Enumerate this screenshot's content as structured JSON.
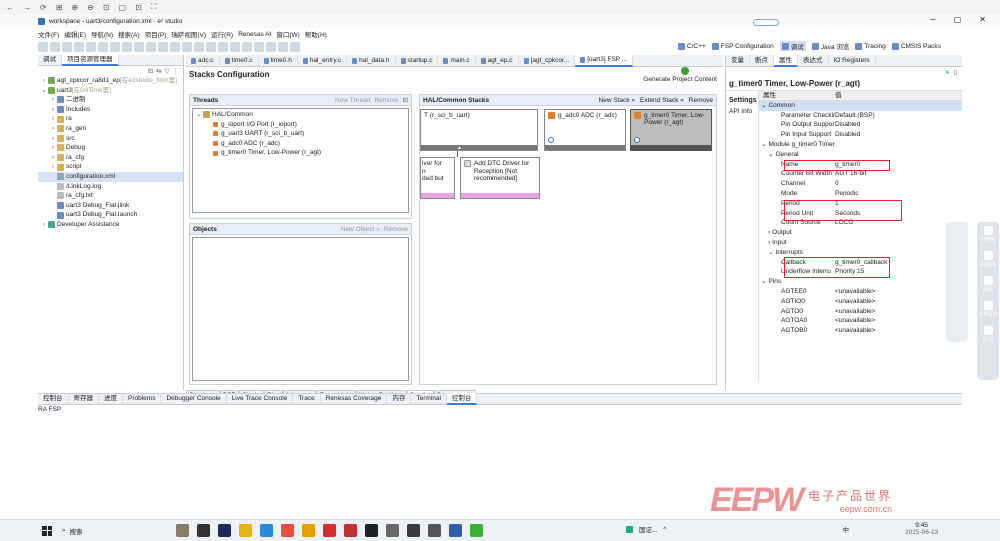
{
  "window": {
    "title": "workspace - uart3/configuration.xml - e² studio",
    "win_controls": [
      "─",
      "▢",
      "✕"
    ]
  },
  "browser_bar": [
    "←",
    "→",
    "⟳",
    "⊞",
    "⊕",
    "⊖",
    "⊡",
    "▢",
    "⊡",
    "⛶"
  ],
  "menu": [
    "文件(F)",
    "编辑(E)",
    "导航(N)",
    "搜索(A)",
    "项目(P)",
    "瑞萨视图(V)",
    "运行(R)",
    "Renesas AI",
    "窗口(W)",
    "帮助(H)"
  ],
  "perspectives": [
    "C/C++",
    "FSP Configuration",
    "调试",
    "Java 浏览",
    "Tracing",
    "CMSIS Packs"
  ],
  "left_tabs": [
    "调试",
    "项目资源管理器"
  ],
  "project_tree": [
    {
      "label": "agt_cpkcor_ra8d1_ep",
      "suffix": "[在e2studio_flom里]",
      "level": 0,
      "arrow": "›",
      "color": "#7a5"
    },
    {
      "label": "uart3",
      "suffix": "[在D4Time里]",
      "level": 0,
      "arrow": "⌄",
      "color": "#7a5"
    },
    {
      "label": "二进制",
      "level": 1,
      "arrow": "›",
      "color": "#6a8cc7"
    },
    {
      "label": "Includes",
      "level": 1,
      "arrow": "›",
      "color": "#6a8cc7"
    },
    {
      "label": "ra",
      "level": 1,
      "arrow": "›",
      "color": "#d9b34a"
    },
    {
      "label": "ra_gen",
      "level": 1,
      "arrow": "›",
      "color": "#d9b34a"
    },
    {
      "label": "src",
      "level": 1,
      "arrow": "›",
      "color": "#d9b34a"
    },
    {
      "label": "Debug",
      "level": 1,
      "arrow": "›",
      "color": "#d9b34a"
    },
    {
      "label": "ra_cfg",
      "level": 1,
      "arrow": "›",
      "color": "#d9b34a"
    },
    {
      "label": "script",
      "level": 1,
      "arrow": "›",
      "color": "#d9b34a"
    },
    {
      "label": "configuration.xml",
      "level": 1,
      "arrow": "",
      "color": "#8aa",
      "selected": true
    },
    {
      "label": "/LinkLog.log",
      "level": 1,
      "arrow": "",
      "color": "#bbb"
    },
    {
      "label": "ra_cfg.txt",
      "level": 1,
      "arrow": "",
      "color": "#bbb"
    },
    {
      "label": "uart3 Debug_Flat.jlink",
      "level": 1,
      "arrow": "",
      "color": "#6a8cc7"
    },
    {
      "label": "uart3 Debug_Flat.launch",
      "level": 1,
      "arrow": "",
      "color": "#6a8cc7"
    },
    {
      "label": "Developer Assistance",
      "level": 0,
      "arrow": "›",
      "color": "#4a8"
    }
  ],
  "editor_tabs": [
    "adc.c",
    "time0.c",
    "time0.h",
    "hal_entry.c",
    "hal_data.h",
    "startup.c",
    "main.c",
    "agt_ep.c",
    "[agt_cpkcor...",
    "[uart3] FSP ..."
  ],
  "stacks": {
    "title": "Stacks Configuration",
    "generate": "Generate Project Content",
    "threads_hdr": "Threads",
    "new_thread": "New Thread",
    "remove": "Remove",
    "thread_root": "HAL/Common",
    "thread_items": [
      "g_ioport I/O Port (r_ioport)",
      "g_uart3 UART (r_sci_b_uart)",
      "g_adc0 ADC (r_adc)",
      "g_timer0 Timer, Low-Power (r_agt)"
    ],
    "objects_hdr": "Objects",
    "new_object": "New Object »",
    "stacks_hdr": "HAL/Common Stacks",
    "new_stack": "New Stack »",
    "extend_stack": "Extend Stack »",
    "cards": [
      "T (r_sci_b_uart)",
      "g_adc0 ADC (r_adc)",
      "g_timer0 Timer, Low-Power (r_agt)"
    ],
    "sub_card_left": [
      "iver for",
      "n",
      "ded but"
    ],
    "sub_card_dtc": "Add DTC Driver for Reception [Not recommended]",
    "bottom_tabs": [
      "Summary",
      "BSP",
      "Clocks",
      "Pins",
      "Interrupts",
      "Event Links",
      "Linker Sections",
      "Stacks",
      "Components"
    ]
  },
  "right_tabs": [
    "变量",
    "断点",
    "属性",
    "表达式",
    "IO Registers"
  ],
  "props": {
    "title": "g_timer0 Timer, Low-Power (r_agt)",
    "side_tabs": [
      "Settings",
      "API Info"
    ],
    "col_key": "属性",
    "col_val": "值",
    "rows": [
      {
        "k": "Common",
        "v": "",
        "lvl": 0,
        "arrow": "⌄",
        "hl": true
      },
      {
        "k": "Parameter Checking",
        "v": "Default (BSP)",
        "lvl": 2,
        "arrow": ""
      },
      {
        "k": "Pin Output Support",
        "v": "Disabled",
        "lvl": 2,
        "arrow": ""
      },
      {
        "k": "Pin Input Support",
        "v": "Disabled",
        "lvl": 2,
        "arrow": ""
      },
      {
        "k": "Module g_timer0 Timer",
        "v": "",
        "lvl": 0,
        "arrow": "⌄"
      },
      {
        "k": "General",
        "v": "",
        "lvl": 1,
        "arrow": "⌄"
      },
      {
        "k": "Name",
        "v": "g_timer0",
        "lvl": 2,
        "arrow": ""
      },
      {
        "k": "Counter Bit Width",
        "v": "AGT 16-bit",
        "lvl": 2,
        "arrow": ""
      },
      {
        "k": "Channel",
        "v": "0",
        "lvl": 2,
        "arrow": ""
      },
      {
        "k": "Mode",
        "v": "Periodic",
        "lvl": 2,
        "arrow": ""
      },
      {
        "k": "Period",
        "v": "1",
        "lvl": 2,
        "arrow": ""
      },
      {
        "k": "Period Unit",
        "v": "Seconds",
        "lvl": 2,
        "arrow": ""
      },
      {
        "k": "Count Source",
        "v": "LOCO",
        "lvl": 2,
        "arrow": ""
      },
      {
        "k": "Output",
        "v": "",
        "lvl": 1,
        "arrow": "›"
      },
      {
        "k": "Input",
        "v": "",
        "lvl": 1,
        "arrow": "›"
      },
      {
        "k": "Interrupts",
        "v": "",
        "lvl": 1,
        "arrow": "⌄"
      },
      {
        "k": "Callback",
        "v": "g_timer0_callback",
        "lvl": 2,
        "arrow": ""
      },
      {
        "k": "Underflow Interru",
        "v": "Priority 15",
        "lvl": 2,
        "arrow": ""
      },
      {
        "k": "Pins",
        "v": "",
        "lvl": 0,
        "arrow": "⌄"
      },
      {
        "k": "AGTEE0",
        "v": "<unavailable>",
        "lvl": 2,
        "arrow": ""
      },
      {
        "k": "AGTIO0",
        "v": "<unavailable>",
        "lvl": 2,
        "arrow": ""
      },
      {
        "k": "AGTO0",
        "v": "<unavailable>",
        "lvl": 2,
        "arrow": ""
      },
      {
        "k": "AGTOA0",
        "v": "<unavailable>",
        "lvl": 2,
        "arrow": ""
      },
      {
        "k": "AGTOB0",
        "v": "<unavailable>",
        "lvl": 2,
        "arrow": ""
      }
    ]
  },
  "side_tools": [
    "AI搜索",
    "AI阅读",
    "翻译",
    "文档写作",
    "标注"
  ],
  "bottom_tabs": [
    "控制台",
    "寄存器",
    "进度",
    "Problems",
    "Debugger Console",
    "Live Trace Console",
    "Trace",
    "Renesas Coverage",
    "内存",
    "Terminal",
    "控制台"
  ],
  "console_label": "RA FSP",
  "taskbar": {
    "search": "搜索",
    "tray_text": "国证...",
    "ime": "中",
    "time": "9:45",
    "date": "2025-06-13"
  },
  "watermark": {
    "logo": "EEPW",
    "cn": "电子产品世界",
    "url": "eepw.com.cn"
  }
}
